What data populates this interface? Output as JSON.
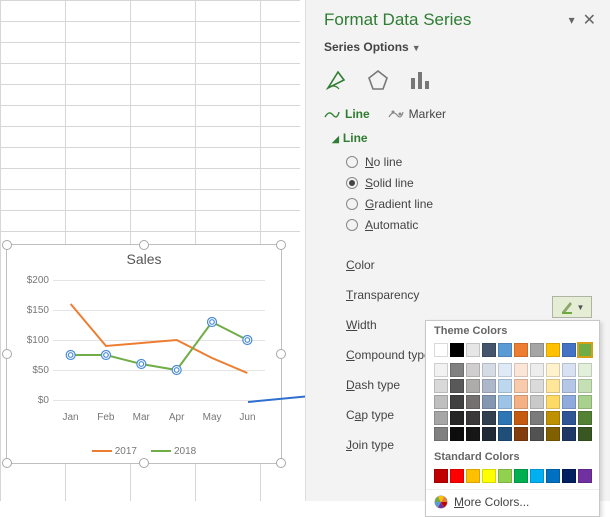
{
  "pane": {
    "title": "Format Data Series",
    "subtitle": "Series Options",
    "tabs": {
      "line": "Line",
      "marker": "Marker"
    },
    "section": "Line",
    "options": {
      "noline": "No line",
      "solid": "Solid line",
      "gradient": "Gradient line",
      "automatic": "Automatic"
    },
    "props": {
      "color": "Color",
      "transparency": "Transparency",
      "width": "Width",
      "compound": "Compound type",
      "dash": "Dash type",
      "cap": "Cap type",
      "join": "Join type"
    }
  },
  "picker": {
    "theme_label": "Theme Colors",
    "standard_label": "Standard Colors",
    "more": "More Colors...",
    "theme_colors": [
      "#ffffff",
      "#000000",
      "#e7e6e6",
      "#44546a",
      "#5b9bd5",
      "#ed7d31",
      "#a5a5a5",
      "#ffc000",
      "#4472c4",
      "#70ad47"
    ],
    "theme_tints": [
      [
        "#f2f2f2",
        "#808080",
        "#d0cece",
        "#d6dce5",
        "#deebf7",
        "#fbe5d6",
        "#ededed",
        "#fff2cc",
        "#d9e2f3",
        "#e2efda"
      ],
      [
        "#d9d9d9",
        "#595959",
        "#aeabab",
        "#adb9ca",
        "#bdd7ee",
        "#f7cbac",
        "#dbdbdb",
        "#ffe699",
        "#b4c7e7",
        "#c5e0b4"
      ],
      [
        "#bfbfbf",
        "#404040",
        "#757070",
        "#8497b0",
        "#9dc3e6",
        "#f4b183",
        "#c9c9c9",
        "#ffd966",
        "#8faadc",
        "#a9d18e"
      ],
      [
        "#a6a6a6",
        "#262626",
        "#3a3838",
        "#323f4f",
        "#2e75b6",
        "#c55a11",
        "#7b7b7b",
        "#bf9000",
        "#2f5597",
        "#548235"
      ],
      [
        "#808080",
        "#0d0d0d",
        "#171616",
        "#222a35",
        "#1f4e79",
        "#833c0b",
        "#525252",
        "#806000",
        "#203864",
        "#385723"
      ]
    ],
    "standard_colors": [
      "#c00000",
      "#ff0000",
      "#ffc000",
      "#ffff00",
      "#92d050",
      "#00b050",
      "#00b0f0",
      "#0070c0",
      "#002060",
      "#7030a0"
    ]
  },
  "chart_data": {
    "type": "line",
    "title": "Sales",
    "ylabel": "",
    "xlabel": "",
    "ylim": [
      0,
      200
    ],
    "yticks": [
      0,
      50,
      100,
      150,
      200
    ],
    "categories": [
      "Jan",
      "Feb",
      "Mar",
      "Apr",
      "May",
      "Jun"
    ],
    "series": [
      {
        "name": "2017",
        "color": "#ed7d31",
        "values": [
          160,
          90,
          95,
          100,
          70,
          45
        ]
      },
      {
        "name": "2018",
        "color": "#70ad47",
        "values": [
          75,
          75,
          60,
          50,
          130,
          100
        ]
      }
    ],
    "ytick_prefix": "$",
    "selected_series": 1
  }
}
